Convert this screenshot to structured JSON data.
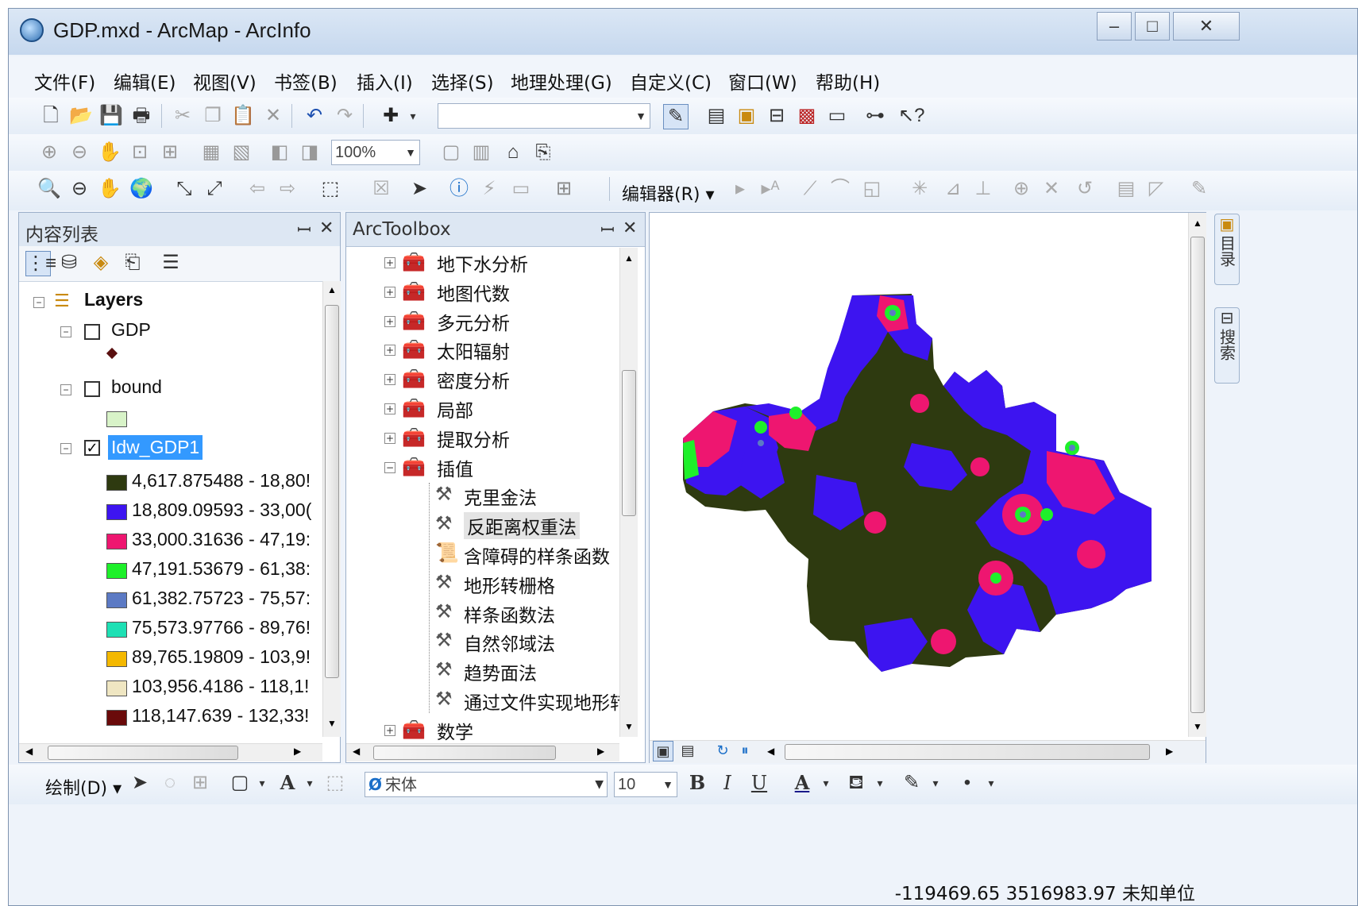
{
  "window": {
    "title": "GDP.mxd - ArcMap - ArcInfo",
    "controls": [
      "‒",
      "□",
      "✕"
    ]
  },
  "menu": [
    "文件(F)",
    "编辑(E)",
    "视图(V)",
    "书签(B)",
    "插入(I)",
    "选择(S)",
    "地理处理(G)",
    "自定义(C)",
    "窗口(W)",
    "帮助(H)"
  ],
  "toolbar2": {
    "zoom_combo": "100%"
  },
  "toolbar3": {
    "editor_label": "编辑器(R)"
  },
  "toc": {
    "title": "内容列表",
    "pin": "ꟷ",
    "close": "✕",
    "root": "Layers",
    "layers": [
      {
        "name": "GDP",
        "checked": false
      },
      {
        "name": "bound",
        "checked": false
      },
      {
        "name": "Idw_GDP1",
        "checked": true
      }
    ],
    "legend": [
      {
        "label": "4,617.875488 - 18,80!",
        "color": "#2e3a10"
      },
      {
        "label": "18,809.09593 - 33,00(",
        "color": "#3d14f0"
      },
      {
        "label": "33,000.31636 - 47,19:",
        "color": "#ee1670"
      },
      {
        "label": "47,191.53679 - 61,38:",
        "color": "#1ef02a"
      },
      {
        "label": "61,382.75723 - 75,57:",
        "color": "#5c7ac4"
      },
      {
        "label": "75,573.97766 - 89,76!",
        "color": "#1ee0b4"
      },
      {
        "label": "89,765.19809 - 103,9!",
        "color": "#f4b800"
      },
      {
        "label": "103,956.4186 - 118,1!",
        "color": "#efe6c2"
      },
      {
        "label": "118,147.639 - 132,33!",
        "color": "#6a0a0a"
      }
    ]
  },
  "toolbox": {
    "title": "ArcToolbox",
    "items": [
      {
        "label": "地下水分析",
        "type": "toolset",
        "expanded": false
      },
      {
        "label": "地图代数",
        "type": "toolset",
        "expanded": false
      },
      {
        "label": "多元分析",
        "type": "toolset",
        "expanded": false
      },
      {
        "label": "太阳辐射",
        "type": "toolset",
        "expanded": false
      },
      {
        "label": "密度分析",
        "type": "toolset",
        "expanded": false
      },
      {
        "label": "局部",
        "type": "toolset",
        "expanded": false
      },
      {
        "label": "提取分析",
        "type": "toolset",
        "expanded": false
      },
      {
        "label": "插值",
        "type": "toolset",
        "expanded": true
      },
      {
        "label": "克里金法",
        "type": "tool"
      },
      {
        "label": "反距离权重法",
        "type": "tool",
        "highlighted": true
      },
      {
        "label": "含障碍的样条函数",
        "type": "script"
      },
      {
        "label": "地形转栅格",
        "type": "tool"
      },
      {
        "label": "样条函数法",
        "type": "tool"
      },
      {
        "label": "自然邻域法",
        "type": "tool"
      },
      {
        "label": "趋势面法",
        "type": "tool"
      },
      {
        "label": "通过文件实现地形转",
        "type": "tool"
      },
      {
        "label": "数学",
        "type": "toolset",
        "expanded": false
      }
    ]
  },
  "side_tabs": [
    "目录",
    "搜索"
  ],
  "draw_toolbar": {
    "draw_label": "绘制(D)",
    "font_name": "宋体",
    "font_size": "10",
    "bold": "B",
    "italic": "I",
    "underline": "U",
    "font_color": "A"
  },
  "status": {
    "coordinates": "-119469.65  3516983.97 未知单位"
  }
}
